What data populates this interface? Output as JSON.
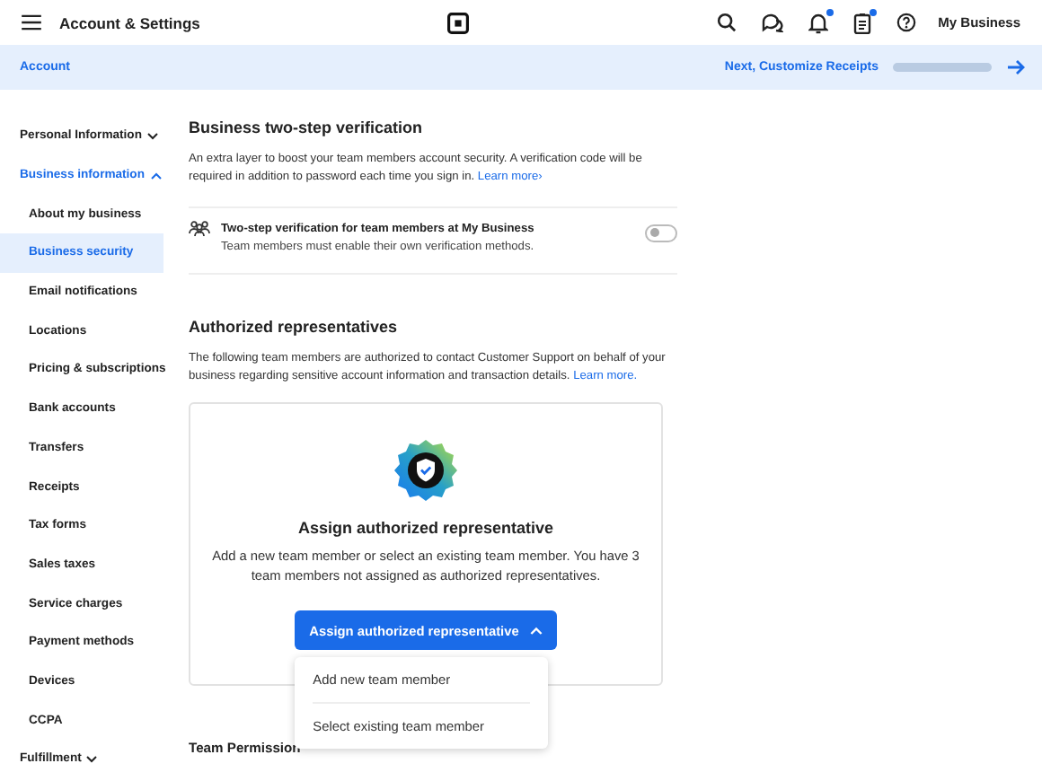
{
  "top_bar": {
    "title": "Account & Settings",
    "icons": [
      {
        "kind": "search",
        "badge": false
      },
      {
        "kind": "chat",
        "badge": false
      },
      {
        "kind": "bell",
        "badge": true
      },
      {
        "kind": "clipboard",
        "badge": true
      },
      {
        "kind": "help",
        "badge": false
      }
    ],
    "account": "My Business"
  },
  "sub_bar": {
    "breadcrumb": "Account",
    "next": "Next, Customize Receipts",
    "progress": {
      "level": 1
    }
  },
  "sidebar": {
    "groups": [
      {
        "label": "Personal Information",
        "expanded": false
      },
      {
        "label": "Business information",
        "expanded": true,
        "items": [
          {
            "label": "About my business",
            "selected": false
          },
          {
            "label": "Business security",
            "selected": true
          },
          {
            "label": "Email notifications",
            "selected": false
          },
          {
            "label": "Locations",
            "selected": false
          },
          {
            "label": "Pricing & subscriptions",
            "selected": false
          },
          {
            "label": "Bank accounts",
            "selected": false
          },
          {
            "label": "Transfers",
            "selected": false
          },
          {
            "label": "Receipts",
            "selected": false
          },
          {
            "label": "Tax forms",
            "selected": false
          },
          {
            "label": "Sales taxes",
            "selected": false
          },
          {
            "label": "Service charges",
            "selected": false
          },
          {
            "label": "Payment methods",
            "selected": false
          },
          {
            "label": "Devices",
            "selected": false
          },
          {
            "label": "CCPA",
            "selected": false
          }
        ]
      },
      {
        "label": "Fulfillment",
        "expanded": false
      }
    ]
  },
  "two_step": {
    "title": "Business two-step verification",
    "description": "An extra layer to boost your team members account security. A verification code will be required in addition to password each time you sign in.",
    "link": "Learn more›",
    "setting": {
      "title": "Two-step verification for team members at My Business",
      "subtitle": "Team members must enable their own verification methods.",
      "on": false
    }
  },
  "representatives": {
    "title": "Authorized representatives",
    "description": "The following team members are authorized to contact Customer Support on behalf of your business regarding sensitive account information and transaction details.",
    "link": "Learn more.",
    "card": {
      "title": "Assign authorized representative",
      "description": "Add a new team member or select an existing team member. You have 3 team members not assigned as authorized representatives.",
      "button": "Assign authorized representative",
      "expanded": true,
      "menu": [
        "Add new team member",
        "Select existing team member"
      ]
    }
  },
  "team_permissions": {
    "title": "Team Permission"
  }
}
